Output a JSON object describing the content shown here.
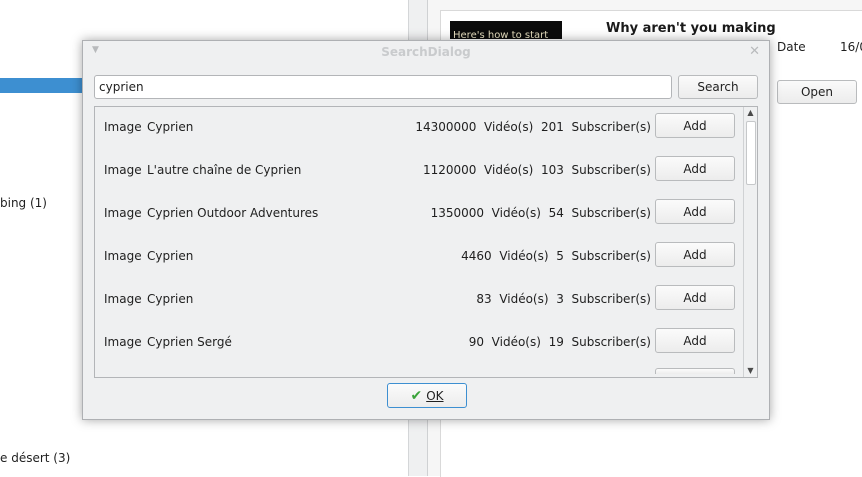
{
  "background": {
    "tree_items": [
      "bing (1)",
      "e désert (3)"
    ],
    "video_thumb_text": "Here's how to start",
    "video_title": "Why aren't you making",
    "date_label": "Date",
    "date_value": "16/0",
    "open_button": "Open"
  },
  "dialog": {
    "title": "SearchDialog",
    "search": {
      "value": "cyprien",
      "button": "Search"
    },
    "results": [
      {
        "thumb": "Image",
        "name": "Cyprien",
        "videos": "14300000",
        "videos_label": "Vidéo(s)",
        "subscribers": "201",
        "subscribers_label": "Subscriber(s)",
        "action": "Add"
      },
      {
        "thumb": "Image",
        "name": "L'autre chaîne de Cyprien",
        "videos": "1120000",
        "videos_label": "Vidéo(s)",
        "subscribers": "103",
        "subscribers_label": "Subscriber(s)",
        "action": "Add"
      },
      {
        "thumb": "Image",
        "name": "Cyprien Outdoor Adventures",
        "videos": "1350000",
        "videos_label": "Vidéo(s)",
        "subscribers": "54",
        "subscribers_label": "Subscriber(s)",
        "action": "Add"
      },
      {
        "thumb": "Image",
        "name": "Cyprien",
        "videos": "4460",
        "videos_label": "Vidéo(s)",
        "subscribers": "5",
        "subscribers_label": "Subscriber(s)",
        "action": "Add"
      },
      {
        "thumb": "Image",
        "name": "Cyprien",
        "videos": "83",
        "videos_label": "Vidéo(s)",
        "subscribers": "3",
        "subscribers_label": "Subscriber(s)",
        "action": "Add"
      },
      {
        "thumb": "Image",
        "name": "Cyprien Sergé",
        "videos": "90",
        "videos_label": "Vidéo(s)",
        "subscribers": "19",
        "subscribers_label": "Subscriber(s)",
        "action": "Add"
      }
    ],
    "ok_button": "OK",
    "ok_icon": "checkmark-icon"
  },
  "colors": {
    "selection": "#3d8fd1",
    "dialog_bg": "#eff0f1",
    "ok_check": "#3aa33a"
  }
}
